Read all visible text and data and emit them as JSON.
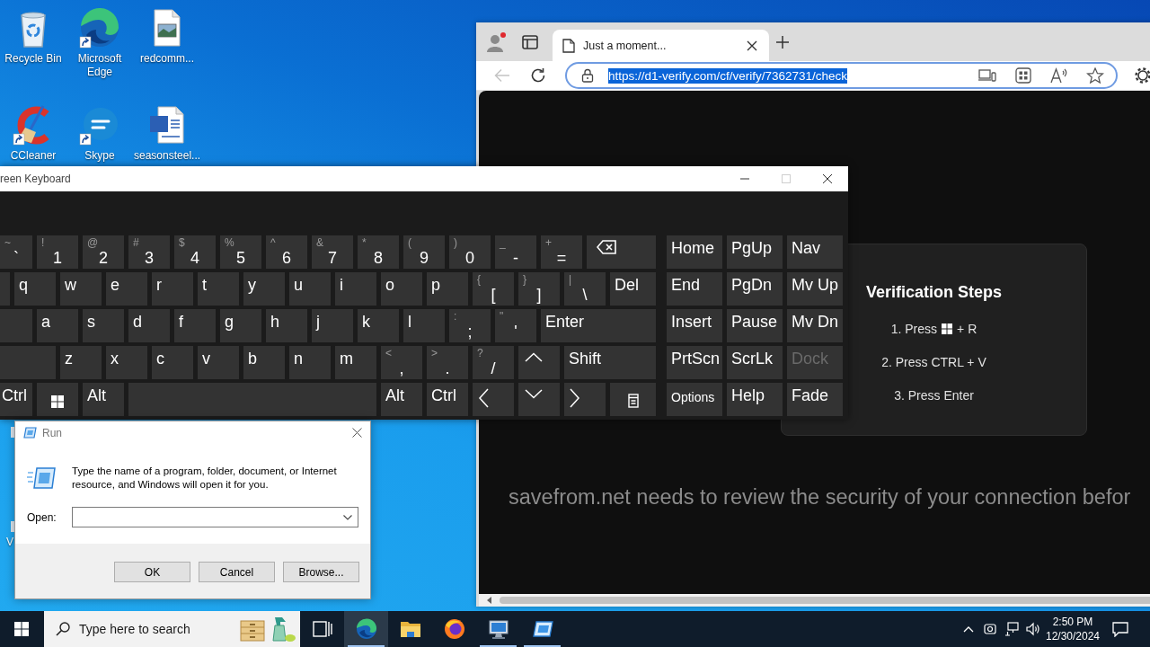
{
  "desktop": {
    "icons": [
      {
        "label": "Recycle Bin",
        "kind": "trash",
        "shortcut": false
      },
      {
        "label": "Microsoft Edge",
        "kind": "browser",
        "shortcut": true
      },
      {
        "label": "redcomm...",
        "kind": "image",
        "shortcut": false
      },
      {
        "label": "CCleaner",
        "kind": "cleaner",
        "shortcut": true
      },
      {
        "label": "Skype",
        "kind": "chat",
        "shortcut": true
      },
      {
        "label": "seasonsteel...",
        "kind": "document",
        "shortcut": false
      }
    ],
    "partly_hidden_icon": {
      "label": "V"
    }
  },
  "browser": {
    "tabs": [
      {
        "title": "Just a moment...",
        "selected": true
      }
    ],
    "back_disabled": true,
    "address": {
      "url": "https://d1-verify.com/cf/verify/7362731/check",
      "selected": true
    },
    "page": {
      "panel": {
        "title": "Verification Steps",
        "steps": [
          {
            "kind": "keycombo",
            "before": "1. Press",
            "after": "+ R"
          },
          {
            "kind": "plain",
            "text": "2. Press CTRL + V"
          },
          {
            "kind": "plain",
            "text": "3. Press Enter"
          }
        ]
      },
      "message": "savefrom.net needs to review the security of your connection befor"
    }
  },
  "keyboard": {
    "title": "reen Keyboard",
    "maximize_disabled": true,
    "rows": [
      [
        {
          "kind": "char",
          "shift": "~",
          "main": "`"
        },
        {
          "kind": "char",
          "shift": "!",
          "main": "1"
        },
        {
          "kind": "char",
          "shift": "@",
          "main": "2"
        },
        {
          "kind": "char",
          "shift": "#",
          "main": "3"
        },
        {
          "kind": "char",
          "shift": "$",
          "main": "4"
        },
        {
          "kind": "char",
          "shift": "%",
          "main": "5"
        },
        {
          "kind": "char",
          "shift": "^",
          "main": "6"
        },
        {
          "kind": "char",
          "shift": "&",
          "main": "7"
        },
        {
          "kind": "char",
          "shift": "*",
          "main": "8"
        },
        {
          "kind": "char",
          "shift": "(",
          "main": "9"
        },
        {
          "kind": "char",
          "shift": ")",
          "main": "0"
        },
        {
          "kind": "char",
          "shift": "_",
          "main": "-"
        },
        {
          "kind": "char",
          "shift": "+",
          "main": "="
        },
        {
          "kind": "backspace"
        }
      ],
      [
        {
          "kind": "blank"
        },
        {
          "kind": "label",
          "label": "q"
        },
        {
          "kind": "label",
          "label": "w"
        },
        {
          "kind": "label",
          "label": "e"
        },
        {
          "kind": "label",
          "label": "r"
        },
        {
          "kind": "label",
          "label": "t"
        },
        {
          "kind": "label",
          "label": "y"
        },
        {
          "kind": "label",
          "label": "u"
        },
        {
          "kind": "label",
          "label": "i"
        },
        {
          "kind": "label",
          "label": "o"
        },
        {
          "kind": "label",
          "label": "p"
        },
        {
          "kind": "char",
          "shift": "{",
          "main": "["
        },
        {
          "kind": "char",
          "shift": "}",
          "main": "]"
        },
        {
          "kind": "char",
          "shift": "|",
          "main": "\\"
        },
        {
          "kind": "label",
          "label": "Del"
        }
      ],
      [
        {
          "kind": "blank"
        },
        {
          "kind": "label",
          "label": "a"
        },
        {
          "kind": "label",
          "label": "s"
        },
        {
          "kind": "label",
          "label": "d"
        },
        {
          "kind": "label",
          "label": "f"
        },
        {
          "kind": "label",
          "label": "g"
        },
        {
          "kind": "label",
          "label": "h"
        },
        {
          "kind": "label",
          "label": "j"
        },
        {
          "kind": "label",
          "label": "k"
        },
        {
          "kind": "label",
          "label": "l"
        },
        {
          "kind": "char",
          "shift": ":",
          "main": ";"
        },
        {
          "kind": "char",
          "shift": "\"",
          "main": "'"
        },
        {
          "kind": "label",
          "label": "Enter"
        }
      ],
      [
        {
          "kind": "blank"
        },
        {
          "kind": "label",
          "label": "z"
        },
        {
          "kind": "label",
          "label": "x"
        },
        {
          "kind": "label",
          "label": "c"
        },
        {
          "kind": "label",
          "label": "v"
        },
        {
          "kind": "label",
          "label": "b"
        },
        {
          "kind": "label",
          "label": "n"
        },
        {
          "kind": "label",
          "label": "m"
        },
        {
          "kind": "char",
          "shift": "<",
          "main": ","
        },
        {
          "kind": "char",
          "shift": ">",
          "main": "."
        },
        {
          "kind": "char",
          "shift": "?",
          "main": "/"
        },
        {
          "kind": "up"
        },
        {
          "kind": "label",
          "label": "Shift"
        }
      ],
      [
        {
          "kind": "label",
          "label": "Ctrl"
        },
        {
          "kind": "winkey"
        },
        {
          "kind": "label",
          "label": "Alt"
        },
        {
          "kind": "space"
        },
        {
          "kind": "label",
          "label": "Alt"
        },
        {
          "kind": "label",
          "label": "Ctrl"
        },
        {
          "kind": "left"
        },
        {
          "kind": "down"
        },
        {
          "kind": "right"
        },
        {
          "kind": "menu"
        }
      ]
    ],
    "nav_keys": [
      {
        "label": "Home",
        "disabled": false
      },
      {
        "label": "PgUp",
        "disabled": false
      },
      {
        "label": "Nav",
        "disabled": false
      },
      {
        "label": "End",
        "disabled": false
      },
      {
        "label": "PgDn",
        "disabled": false
      },
      {
        "label": "Mv Up",
        "disabled": false
      },
      {
        "label": "Insert",
        "disabled": false
      },
      {
        "label": "Pause",
        "disabled": false
      },
      {
        "label": "Mv Dn",
        "disabled": false
      },
      {
        "label": "PrtScn",
        "disabled": false
      },
      {
        "label": "ScrLk",
        "disabled": false
      },
      {
        "label": "Dock",
        "disabled": true
      },
      {
        "label": "Options",
        "disabled": false
      },
      {
        "label": "Help",
        "disabled": false
      },
      {
        "label": "Fade",
        "disabled": false
      }
    ]
  },
  "run_dialog": {
    "title": "Run",
    "description": "Type the name of a program, folder, document, or Internet resource, and Windows will open it for you.",
    "open_label": "Open:",
    "buttons": [
      "OK",
      "Cancel",
      "Browse..."
    ]
  },
  "taskbar": {
    "search": {
      "placeholder": "Type here to search"
    },
    "apps": [
      {
        "kind": "taskview",
        "running": false,
        "selected": false
      },
      {
        "kind": "browser",
        "running": true,
        "selected": true
      },
      {
        "kind": "folder",
        "running": false,
        "selected": false
      },
      {
        "kind": "firefox",
        "running": false,
        "selected": false
      },
      {
        "kind": "computer",
        "running": true,
        "selected": false
      },
      {
        "kind": "run",
        "running": true,
        "selected": false
      }
    ],
    "clock": {
      "time": "2:50 PM",
      "date": "12/30/2024"
    }
  }
}
